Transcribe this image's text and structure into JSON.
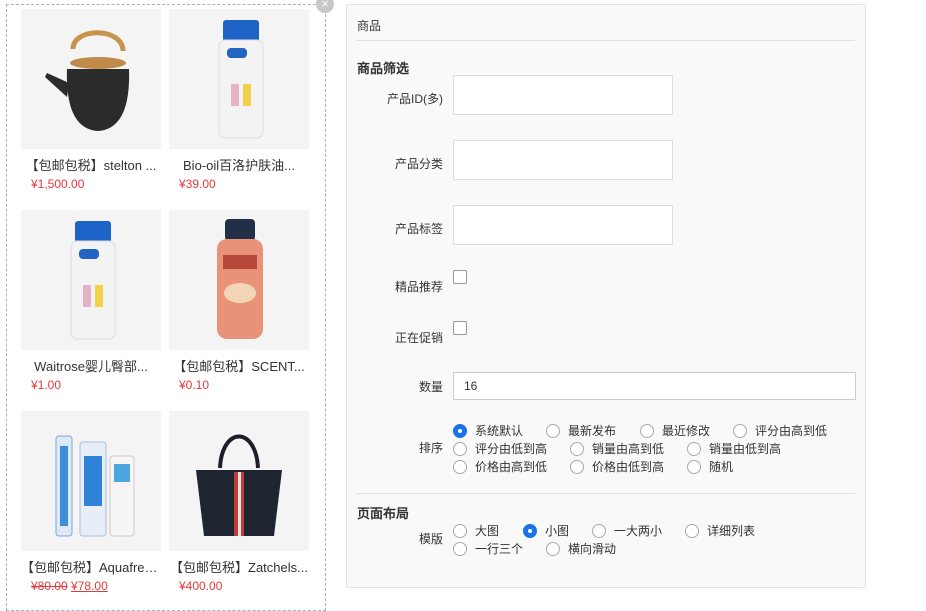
{
  "close_glyph": "×",
  "products": [
    {
      "title": "【包邮包税】stelton ...",
      "price": "¥1,500.00",
      "old_price": "",
      "image": "teapot"
    },
    {
      "title": "Bio-oil百洛护肤油...",
      "price": "¥39.00",
      "old_price": "",
      "image": "e45-lotion"
    },
    {
      "title": "Waitrose婴儿臀部...",
      "price": "¥1.00",
      "old_price": "",
      "image": "e45-lotion"
    },
    {
      "title": "【包邮包税】SCENT...",
      "price": "¥0.10",
      "old_price": "",
      "image": "body-wash"
    },
    {
      "title": "【包邮包税】Aquafresh...",
      "price": "¥78.00",
      "old_price": "¥80.00",
      "image": "toothbrush-set"
    },
    {
      "title": "【包邮包税】Zatchels...",
      "price": "¥400.00",
      "old_price": "",
      "image": "handbag"
    }
  ],
  "panel": {
    "header": "商品",
    "filter_section": "商品筛选",
    "fields": {
      "product_id_label": "产品ID(多)",
      "category_label": "产品分类",
      "tag_label": "产品标签",
      "featured_label": "精品推荐",
      "promo_label": "正在促销",
      "quantity_label": "数量",
      "quantity_value": "16",
      "sort_label": "排序"
    },
    "sort_options": [
      {
        "label": "系统默认",
        "checked": true
      },
      {
        "label": "最新发布",
        "checked": false
      },
      {
        "label": "最近修改",
        "checked": false
      },
      {
        "label": "评分由高到低",
        "checked": false
      },
      {
        "label": "评分由低到高",
        "checked": false
      },
      {
        "label": "销量由高到低",
        "checked": false
      },
      {
        "label": "销量由低到高",
        "checked": false
      },
      {
        "label": "价格由高到低",
        "checked": false
      },
      {
        "label": "价格由低到高",
        "checked": false
      },
      {
        "label": "随机",
        "checked": false
      }
    ],
    "layout_section": "页面布局",
    "template_label": "模版",
    "template_options": [
      {
        "label": "大图",
        "checked": false
      },
      {
        "label": "小图",
        "checked": true
      },
      {
        "label": "一大两小",
        "checked": false
      },
      {
        "label": "详细列表",
        "checked": false
      },
      {
        "label": "一行三个",
        "checked": false
      },
      {
        "label": "横向滑动",
        "checked": false
      }
    ]
  },
  "colors": {
    "accent": "#1a73e8",
    "price": "#e4393c"
  }
}
